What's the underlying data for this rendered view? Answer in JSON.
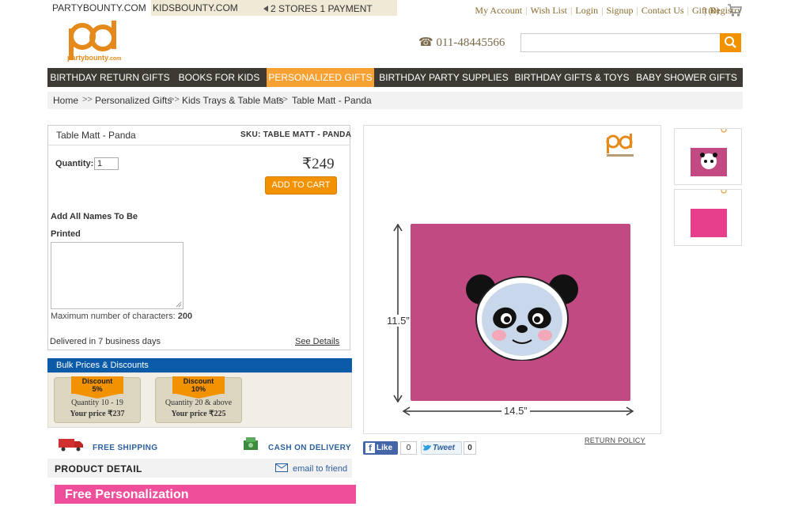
{
  "top": {
    "site_tabs": [
      "PARTYBOUNTY.COM",
      "KIDSBOUNTY.COM"
    ],
    "stores_note": "2 STORES 1 PAYMENT",
    "links": [
      "My Account",
      "Wish List",
      "Login",
      "Signup",
      "Contact Us",
      "Gift Registry"
    ],
    "cart_count": "| (0)"
  },
  "logo": {
    "text": "partybounty",
    "suffix": ".com",
    "letters": "pb"
  },
  "phone": "011-48445566",
  "search": {
    "placeholder": ""
  },
  "nav": {
    "items": [
      "BIRTHDAY RETURN GIFTS",
      "BOOKS FOR KIDS",
      "PERSONALIZED GIFTS",
      "BIRTHDAY PARTY SUPPLIES",
      "BIRTHDAY GIFTS & TOYS",
      "BABY SHOWER GIFTS"
    ],
    "active_index": 2
  },
  "breadcrumb": {
    "items": [
      "Home",
      "Personalized Gifts",
      "Kids Trays & Table Mats",
      "Table Matt - Panda"
    ],
    "separator": ">>"
  },
  "product": {
    "title": "Table Matt - Panda",
    "sku": "SKU: TABLE MATT - PANDA",
    "quantity_label": "Quantity:",
    "quantity_value": "1",
    "price": "₹249",
    "add_to_cart": "ADD TO CART",
    "names_label": "Add All Names To Be",
    "printed_label": "Printed",
    "max_chars_label": "Maximum number of characters:",
    "max_chars_value": "200",
    "delivery": "Delivered in 7 business days",
    "see_details": "See Details"
  },
  "bulk": {
    "heading": "Bulk Prices & Discounts",
    "tiers": [
      {
        "discount": "Discount",
        "pct": "5%",
        "qty": "Quantity 10 - 19",
        "price": "Your price ₹237"
      },
      {
        "discount": "Discount",
        "pct": "10%",
        "qty": "Quantity 20 & above",
        "price": "Your price ₹225"
      }
    ]
  },
  "shipping": {
    "free_shipping": "FREE SHIPPING",
    "cod": "CASH ON DELIVERY"
  },
  "detail": {
    "heading": "PRODUCT DETAIL",
    "email_friend": "email to friend",
    "banner": "Free Personalization"
  },
  "image": {
    "height_label": "11.5”",
    "width_label": "14.5”",
    "mat_color": "#c04a81",
    "alt_mat_color": "#e83f8c"
  },
  "social": {
    "return_policy": "RETURN POLICY",
    "like": "Like",
    "like_count": "0",
    "tweet": "Tweet",
    "tweet_count": "0"
  },
  "colors": {
    "accent": "#f39200",
    "nav_bg": "#3d3a33",
    "nav_active": "#f7a133",
    "bulk_head": "#0b5ba8",
    "banner": "#ef4f9a"
  }
}
